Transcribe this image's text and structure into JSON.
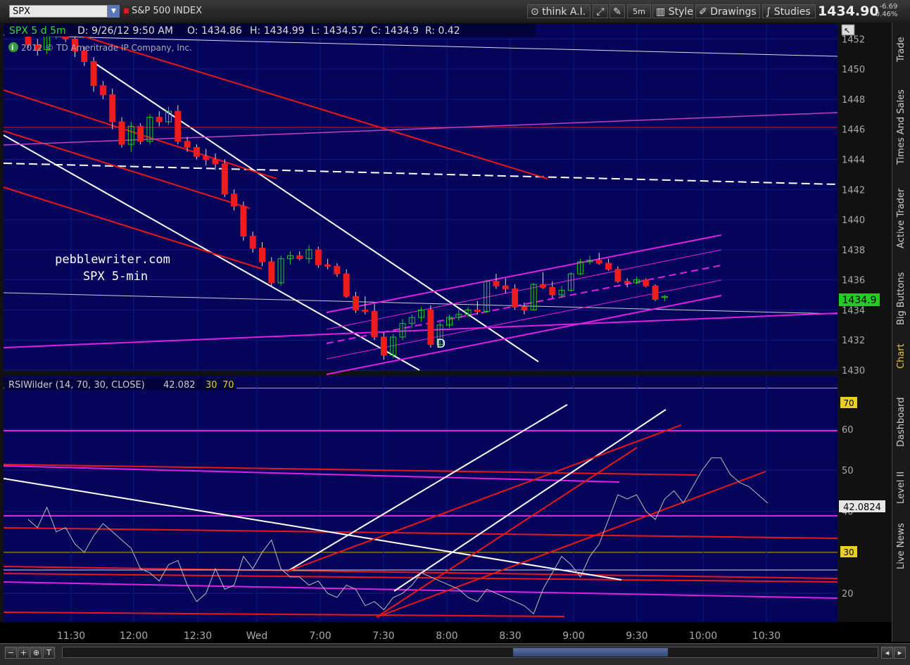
{
  "toolbar": {
    "symbol": "SPX",
    "index_name": "S&P 500 INDEX",
    "think_label": "think A.I.",
    "interval_label": "5m",
    "style_label": "Style",
    "drawings_label": "Drawings",
    "studies_label": "Studies",
    "last_price": "1434.90",
    "change": "-6.69",
    "change_pct": "-0.46%"
  },
  "sidebar": {
    "tabs": [
      "Trade",
      "Times And Sales",
      "Active Trader",
      "Big Buttons",
      "Chart",
      "Dashboard",
      "Level II",
      "Live News"
    ],
    "active": "Chart"
  },
  "chart": {
    "header": {
      "symbol": "SPX 5 d 5m",
      "date": "D: 9/26/12 9:50 AM",
      "open": "O: 1434.86",
      "high": "H: 1434.99",
      "low": "L: 1434.57",
      "close": "C: 1434.9",
      "range": "R: 0.42"
    },
    "copyright": "2012 © TD Ameritrade IP Company, Inc.",
    "annotation": [
      "pebblewriter.com",
      "SPX 5-min"
    ],
    "marker": "D",
    "price_badge": "1434.9",
    "rsi_header": "RSIWilder (14, 70, 30, CLOSE)",
    "rsi_value": "42.082",
    "rsi_levels": [
      "30",
      "70"
    ],
    "rsi_badge": "42.0824",
    "rsi_badge_70": "70",
    "rsi_badge_30": "30"
  },
  "chart_data": [
    {
      "type": "candlestick",
      "title": "SPX 5 d 5m",
      "ylim": [
        1430,
        1453
      ],
      "yticks": [
        1430,
        1432,
        1434,
        1436,
        1438,
        1440,
        1442,
        1444,
        1446,
        1448,
        1450,
        1452
      ],
      "xticks": [
        "11:30",
        "12:00",
        "12:30",
        "Wed",
        "7:00",
        "7:30",
        "8:00",
        "8:30",
        "9:00",
        "9:30",
        "10:00",
        "10:30"
      ],
      "candles": [
        [
          1452.2,
          1452.6,
          1451.4,
          1451.6
        ],
        [
          1451.6,
          1452.0,
          1450.9,
          1451.3
        ],
        [
          1451.3,
          1452.7,
          1451.0,
          1452.4
        ],
        [
          1452.4,
          1453.0,
          1452.0,
          1452.6
        ],
        [
          1452.6,
          1452.9,
          1451.8,
          1452.0
        ],
        [
          1452.0,
          1452.3,
          1450.8,
          1451.2
        ],
        [
          1451.2,
          1451.5,
          1450.2,
          1450.5
        ],
        [
          1450.5,
          1450.8,
          1448.5,
          1448.9
        ],
        [
          1448.9,
          1449.2,
          1448.0,
          1448.3
        ],
        [
          1448.3,
          1448.7,
          1446.0,
          1446.5
        ],
        [
          1446.5,
          1446.8,
          1444.8,
          1445.0
        ],
        [
          1445.0,
          1446.5,
          1444.5,
          1446.2
        ],
        [
          1446.2,
          1446.4,
          1445.0,
          1445.2
        ],
        [
          1445.2,
          1447.0,
          1445.0,
          1446.8
        ],
        [
          1446.8,
          1447.2,
          1446.2,
          1446.5
        ],
        [
          1446.5,
          1447.5,
          1446.3,
          1447.2
        ],
        [
          1447.2,
          1447.6,
          1445.0,
          1445.2
        ],
        [
          1445.2,
          1445.5,
          1444.5,
          1444.8
        ],
        [
          1444.8,
          1445.0,
          1444.0,
          1444.2
        ],
        [
          1444.2,
          1444.7,
          1443.6,
          1444.0
        ],
        [
          1444.0,
          1444.4,
          1443.3,
          1443.7
        ],
        [
          1443.7,
          1444.0,
          1441.5,
          1441.7
        ],
        [
          1441.7,
          1442.0,
          1440.6,
          1440.9
        ],
        [
          1440.9,
          1441.2,
          1438.6,
          1438.9
        ],
        [
          1438.9,
          1439.2,
          1437.8,
          1438.1
        ],
        [
          1438.1,
          1438.5,
          1436.9,
          1437.2
        ],
        [
          1437.2,
          1437.5,
          1435.6,
          1435.8
        ],
        [
          1435.8,
          1437.6,
          1435.6,
          1437.4
        ],
        [
          1437.4,
          1437.9,
          1437.0,
          1437.6
        ],
        [
          1437.6,
          1437.9,
          1437.3,
          1437.4
        ],
        [
          1437.4,
          1438.3,
          1437.1,
          1438.0
        ],
        [
          1438.0,
          1438.2,
          1436.8,
          1437.0
        ],
        [
          1437.0,
          1437.4,
          1436.7,
          1436.9
        ],
        [
          1436.9,
          1437.1,
          1436.2,
          1436.4
        ],
        [
          1436.4,
          1436.7,
          1434.8,
          1434.9
        ],
        [
          1434.9,
          1435.2,
          1433.8,
          1434.0
        ],
        [
          1434.0,
          1434.9,
          1433.7,
          1433.9
        ],
        [
          1433.9,
          1434.4,
          1432.0,
          1432.2
        ],
        [
          1432.2,
          1432.5,
          1430.7,
          1431.0
        ],
        [
          1431.0,
          1432.4,
          1430.8,
          1432.2
        ],
        [
          1432.2,
          1433.4,
          1432.0,
          1433.1
        ],
        [
          1433.1,
          1433.7,
          1432.8,
          1433.5
        ],
        [
          1433.5,
          1434.2,
          1433.2,
          1434.0
        ],
        [
          1434.0,
          1434.3,
          1431.5,
          1431.7
        ],
        [
          1431.7,
          1433.2,
          1431.5,
          1433.0
        ],
        [
          1433.0,
          1433.7,
          1432.8,
          1433.5
        ],
        [
          1433.5,
          1434.0,
          1433.3,
          1433.7
        ],
        [
          1433.7,
          1434.2,
          1433.5,
          1434.0
        ],
        [
          1434.0,
          1434.6,
          1433.7,
          1433.9
        ],
        [
          1433.9,
          1436.0,
          1433.8,
          1435.9
        ],
        [
          1435.9,
          1436.4,
          1435.4,
          1435.6
        ],
        [
          1435.6,
          1436.1,
          1435.1,
          1435.4
        ],
        [
          1435.4,
          1435.7,
          1434.0,
          1434.2
        ],
        [
          1434.2,
          1434.5,
          1433.7,
          1434.0
        ],
        [
          1434.0,
          1435.8,
          1434.0,
          1435.7
        ],
        [
          1435.7,
          1436.5,
          1435.4,
          1435.5
        ],
        [
          1435.5,
          1435.9,
          1434.8,
          1435.0
        ],
        [
          1435.0,
          1435.6,
          1434.8,
          1435.3
        ],
        [
          1435.3,
          1436.5,
          1435.2,
          1436.4
        ],
        [
          1436.4,
          1437.4,
          1436.3,
          1437.2
        ],
        [
          1437.2,
          1437.6,
          1437.0,
          1437.3
        ],
        [
          1437.3,
          1437.8,
          1437.0,
          1437.1
        ],
        [
          1437.1,
          1437.4,
          1436.6,
          1436.7
        ],
        [
          1436.7,
          1436.9,
          1435.8,
          1435.9
        ],
        [
          1435.9,
          1436.1,
          1435.5,
          1435.8
        ],
        [
          1435.8,
          1436.2,
          1435.7,
          1436.0
        ],
        [
          1436.0,
          1436.1,
          1435.5,
          1435.6
        ],
        [
          1435.6,
          1435.7,
          1434.6,
          1434.7
        ],
        [
          1434.86,
          1434.99,
          1434.57,
          1434.9
        ]
      ]
    },
    {
      "type": "line",
      "title": "RSIWilder (14, 70, 30, CLOSE)",
      "ylim": [
        13,
        73
      ],
      "yticks": [
        20,
        30,
        40,
        50,
        60,
        70
      ],
      "series": [
        {
          "values": [
            38,
            36,
            41,
            35,
            36,
            32,
            30,
            34,
            37,
            35,
            33,
            31,
            26,
            25,
            23,
            27,
            28,
            22,
            18,
            20,
            26,
            21,
            22,
            29,
            26,
            30,
            33,
            26,
            24,
            24,
            22,
            23,
            20,
            19,
            22,
            21,
            17,
            18,
            16,
            19,
            20,
            22,
            25,
            24,
            23,
            22,
            21,
            19,
            18,
            21,
            20,
            19,
            18,
            17,
            15,
            21,
            25,
            29,
            27,
            24,
            29,
            32,
            38,
            44,
            43,
            44,
            40,
            38,
            43,
            45,
            42,
            46,
            50,
            53,
            53,
            49,
            47,
            46,
            44,
            42
          ]
        }
      ]
    }
  ]
}
